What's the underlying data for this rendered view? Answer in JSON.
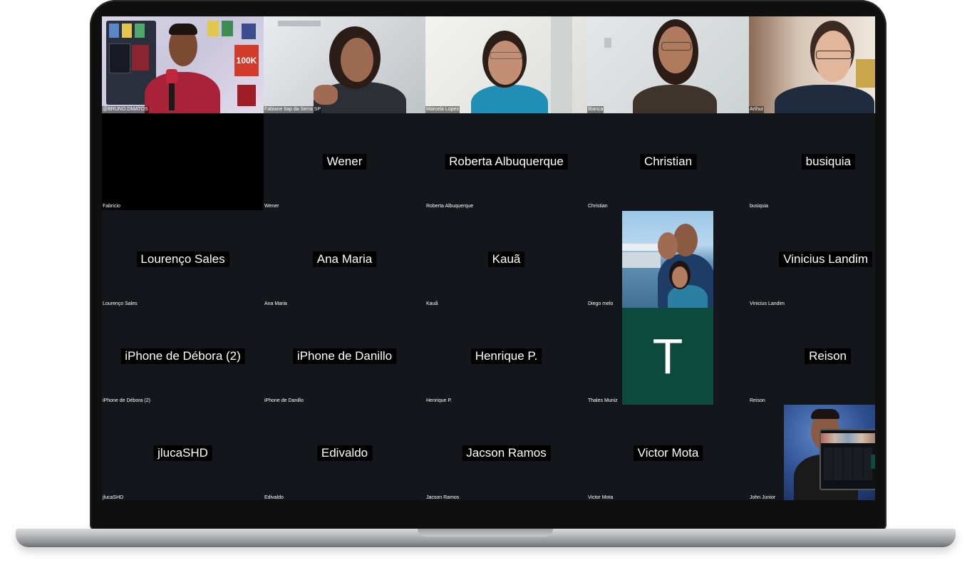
{
  "meeting": {
    "video_participants": [
      {
        "tile_label": "@BRUNO.DMATOS"
      },
      {
        "tile_label": "Fabiane Itap da Serra SP"
      },
      {
        "tile_label": "Marcela Lopes"
      },
      {
        "tile_label": "Bianca"
      },
      {
        "tile_label": "Arthur"
      }
    ],
    "name_tiles": [
      {
        "tile_label": "Fabricio",
        "display": ""
      },
      {
        "tile_label": "Wener",
        "display": "Wener"
      },
      {
        "tile_label": "Roberta Albuquerque",
        "display": "Roberta Albuquerque"
      },
      {
        "tile_label": "Christian",
        "display": "Christian"
      },
      {
        "tile_label": "busiquia",
        "display": "busiquia"
      },
      {
        "tile_label": "Lourenço Sales",
        "display": "Lourenço Sales"
      },
      {
        "tile_label": "Ana Maria",
        "display": "Ana Maria"
      },
      {
        "tile_label": "Kauã",
        "display": "Kauã"
      },
      {
        "tile_label": "Diego melo",
        "display": ""
      },
      {
        "tile_label": "Vinicius Landim",
        "display": "Vinicius Landim"
      },
      {
        "tile_label": "iPhone de Débora (2)",
        "display": "iPhone de Débora (2)"
      },
      {
        "tile_label": "iPhone de Danillo",
        "display": "iPhone de Danillo"
      },
      {
        "tile_label": "Henrique P.",
        "display": "Henrique P."
      },
      {
        "tile_label": "Thales Muniz",
        "display": "T"
      },
      {
        "tile_label": "Reison",
        "display": "Reison"
      },
      {
        "tile_label": "jlucaSHD",
        "display": "jlucaSHD"
      },
      {
        "tile_label": "Edivaldo",
        "display": "Edivaldo"
      },
      {
        "tile_label": "Jacson Ramos",
        "display": "Jacson Ramos"
      },
      {
        "tile_label": "Victor Mota",
        "display": "Victor Mota"
      },
      {
        "tile_label": "John Junior",
        "display": ""
      }
    ],
    "bruno_backdrop_text": "100K",
    "avatar_color": "#0c4a3e"
  }
}
